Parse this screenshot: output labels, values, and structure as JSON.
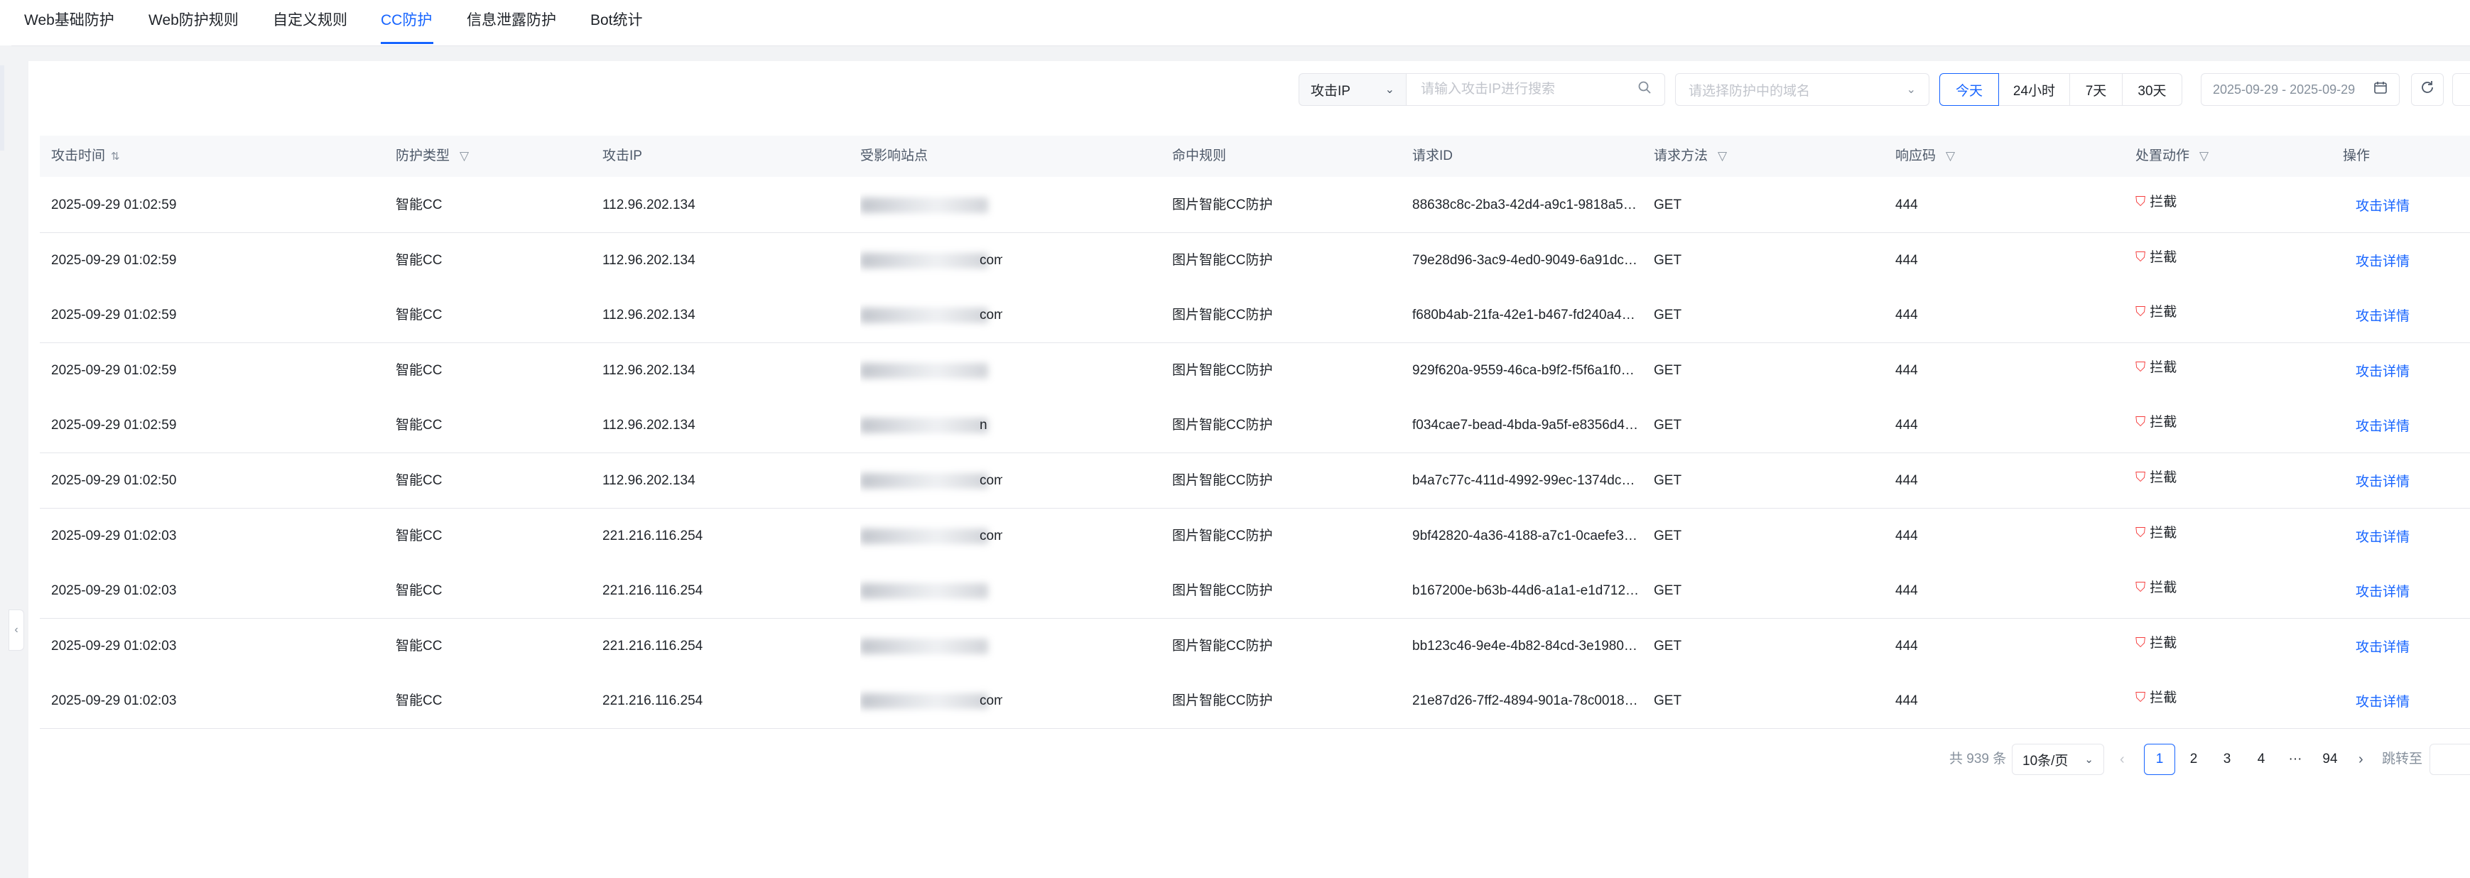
{
  "tabs": [
    {
      "label": "Web基础防护"
    },
    {
      "label": "Web防护规则"
    },
    {
      "label": "自定义规则"
    },
    {
      "label": "CC防护"
    },
    {
      "label": "信息泄露防护"
    },
    {
      "label": "Bot统计"
    }
  ],
  "active_tab": "CC防护",
  "toolbar": {
    "filter_type": "攻击IP",
    "search_placeholder": "请输入攻击IP进行搜索",
    "domain_placeholder": "请选择防护中的域名",
    "ranges": [
      "今天",
      "24小时",
      "7天",
      "30天"
    ],
    "active_range": "今天",
    "date_range": "2025-09-29 - 2025-09-29"
  },
  "table": {
    "columns": [
      "攻击时间",
      "防护类型",
      "攻击IP",
      "受影响站点",
      "命中规则",
      "请求ID",
      "请求方法",
      "响应码",
      "处置动作",
      "操作"
    ],
    "rows": [
      {
        "time": "2025-09-29 01:02:59",
        "type": "智能CC",
        "ip": "112.96.202.134",
        "site_tail": "",
        "rule": "图片智能CC防护",
        "request_id": "88638c8c-2ba3-42d4-a9c1-9818a52…",
        "method": "GET",
        "code": "444",
        "action": "拦截",
        "op": "攻击详情"
      },
      {
        "time": "2025-09-29 01:02:59",
        "type": "智能CC",
        "ip": "112.96.202.134",
        "site_tail": "com",
        "rule": "图片智能CC防护",
        "request_id": "79e28d96-3ac9-4ed0-9049-6a91dc…",
        "method": "GET",
        "code": "444",
        "action": "拦截",
        "op": "攻击详情"
      },
      {
        "time": "2025-09-29 01:02:59",
        "type": "智能CC",
        "ip": "112.96.202.134",
        "site_tail": "com",
        "rule": "图片智能CC防护",
        "request_id": "f680b4ab-21fa-42e1-b467-fd240a4a…",
        "method": "GET",
        "code": "444",
        "action": "拦截",
        "op": "攻击详情"
      },
      {
        "time": "2025-09-29 01:02:59",
        "type": "智能CC",
        "ip": "112.96.202.134",
        "site_tail": "",
        "rule": "图片智能CC防护",
        "request_id": "929f620a-9559-46ca-b9f2-f5f6a1f0d…",
        "method": "GET",
        "code": "444",
        "action": "拦截",
        "op": "攻击详情"
      },
      {
        "time": "2025-09-29 01:02:59",
        "type": "智能CC",
        "ip": "112.96.202.134",
        "site_tail": "n",
        "rule": "图片智能CC防护",
        "request_id": "f034cae7-bead-4bda-9a5f-e8356d4…",
        "method": "GET",
        "code": "444",
        "action": "拦截",
        "op": "攻击详情"
      },
      {
        "time": "2025-09-29 01:02:50",
        "type": "智能CC",
        "ip": "112.96.202.134",
        "site_tail": "com",
        "rule": "图片智能CC防护",
        "request_id": "b4a7c77c-411d-4992-99ec-1374dc0…",
        "method": "GET",
        "code": "444",
        "action": "拦截",
        "op": "攻击详情"
      },
      {
        "time": "2025-09-29 01:02:03",
        "type": "智能CC",
        "ip": "221.216.116.254",
        "site_tail": "com",
        "rule": "图片智能CC防护",
        "request_id": "9bf42820-4a36-4188-a7c1-0caefe3…",
        "method": "GET",
        "code": "444",
        "action": "拦截",
        "op": "攻击详情"
      },
      {
        "time": "2025-09-29 01:02:03",
        "type": "智能CC",
        "ip": "221.216.116.254",
        "site_tail": "",
        "rule": "图片智能CC防护",
        "request_id": "b167200e-b63b-44d6-a1a1-e1d712…",
        "method": "GET",
        "code": "444",
        "action": "拦截",
        "op": "攻击详情"
      },
      {
        "time": "2025-09-29 01:02:03",
        "type": "智能CC",
        "ip": "221.216.116.254",
        "site_tail": "",
        "rule": "图片智能CC防护",
        "request_id": "bb123c46-9e4e-4b82-84cd-3e1980…",
        "method": "GET",
        "code": "444",
        "action": "拦截",
        "op": "攻击详情"
      },
      {
        "time": "2025-09-29 01:02:03",
        "type": "智能CC",
        "ip": "221.216.116.254",
        "site_tail": "com",
        "rule": "图片智能CC防护",
        "request_id": "21e87d26-7ff2-4894-901a-78c0018…",
        "method": "GET",
        "code": "444",
        "action": "拦截",
        "op": "攻击详情"
      }
    ]
  },
  "pagination": {
    "total_text": "共 939 条",
    "page_size": "10条/页",
    "pages": [
      "1",
      "2",
      "3",
      "4",
      "···",
      "94"
    ],
    "current": "1",
    "jump_label": "跳转至"
  },
  "colors": {
    "accent": "#1664ff",
    "danger": "#f53f3f",
    "border": "#e5e6eb",
    "header_bg": "#f7f8fa"
  },
  "icons": {
    "search": "search-icon",
    "calendar": "calendar-icon",
    "refresh": "refresh-icon",
    "filter": "filter-icon",
    "sort": "sort-icon",
    "shield": "shield-block-icon"
  }
}
